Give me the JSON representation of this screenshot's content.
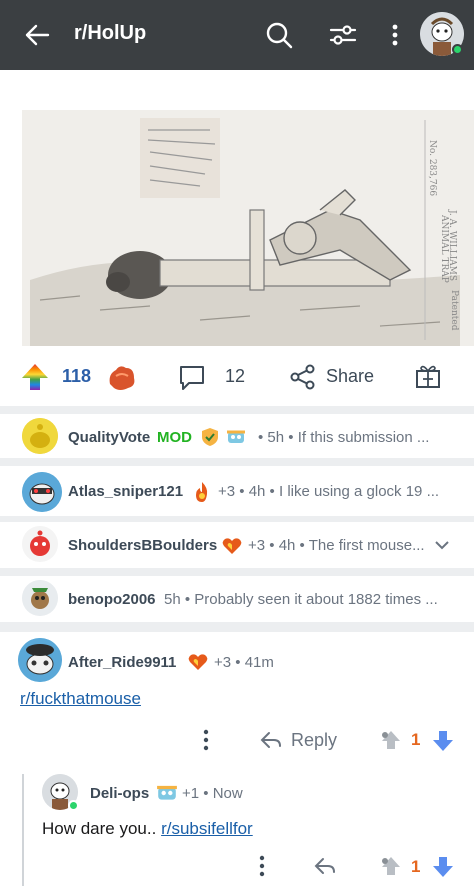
{
  "header": {
    "subreddit": "r/HolUp",
    "back_icon": "arrow-left-icon",
    "search_icon": "search-icon",
    "filter_icon": "sliders-icon",
    "more_icon": "more-vertical-icon"
  },
  "post": {
    "image_description_icon": "patent-drawing-image",
    "score": "118",
    "comment_count": "12",
    "share_label": "Share"
  },
  "collapsed_comments": [
    {
      "username": "QualityVote",
      "mod_label": "MOD",
      "extra": "",
      "time": "• 5h •",
      "preview": "If this submission ..."
    },
    {
      "username": "Atlas_sniper121",
      "mod_label": "",
      "extra": "+3",
      "time": "• 4h •",
      "preview": "I like using a glock 19 ..."
    },
    {
      "username": "ShouldersBBoulders",
      "mod_label": "",
      "extra": "+3",
      "time": "• 4h •",
      "preview": "The first mouse..."
    },
    {
      "username": "benopo2006",
      "mod_label": "",
      "extra": "",
      "time": "5h •",
      "preview": "Probably seen it about 1882 times ..."
    }
  ],
  "expanded_comment": {
    "username": "After_Ride9911",
    "extra": "+3",
    "time": "• 41m",
    "body_link": "r/fuckthatmouse",
    "reply_label": "Reply",
    "score": "1"
  },
  "reply_comment": {
    "username": "Deli-ops",
    "extra": "+1",
    "time": "• Now",
    "body_text": "How dare you..",
    "body_link": "r/subsifellfor",
    "score": "1"
  },
  "colors": {
    "topbar": "#3b3f42",
    "mod_green": "#22b322",
    "link_blue": "#1a5fa8",
    "upvote_orange": "#e5671f",
    "downvote_blue": "#5b8def"
  }
}
